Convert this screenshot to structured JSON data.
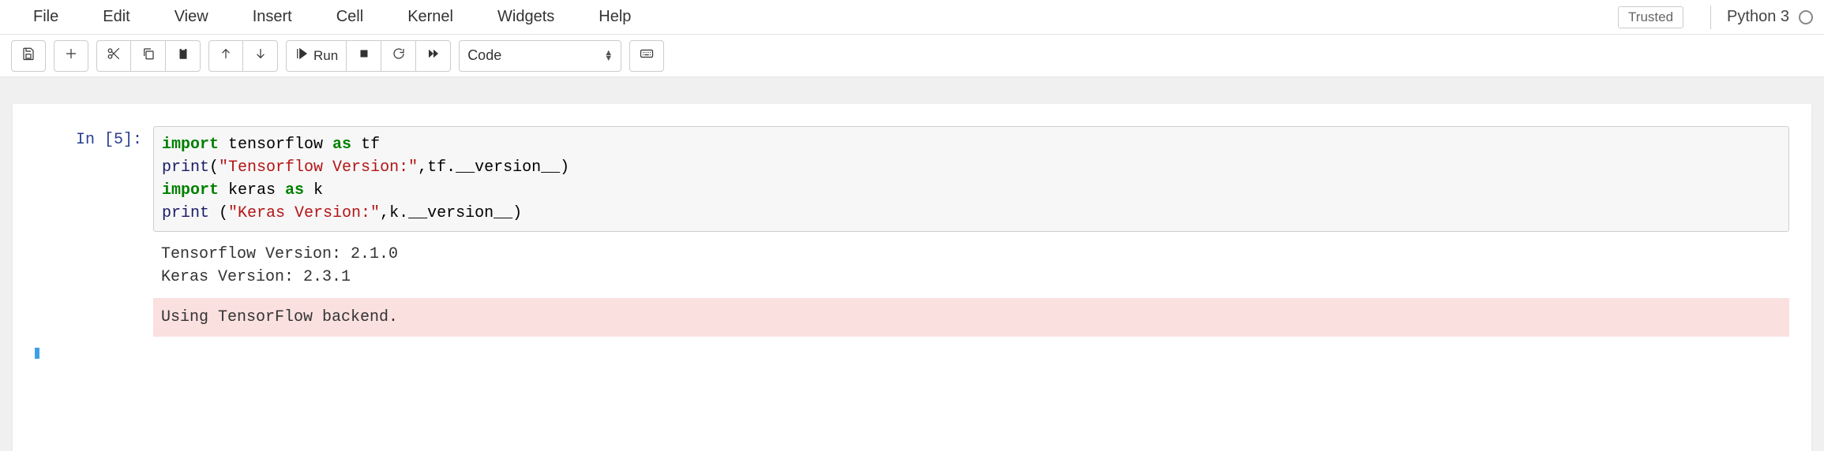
{
  "menubar": {
    "items": [
      "File",
      "Edit",
      "View",
      "Insert",
      "Cell",
      "Kernel",
      "Widgets",
      "Help"
    ],
    "trusted_label": "Trusted",
    "kernel_name": "Python 3"
  },
  "toolbar": {
    "save_title": "Save and Checkpoint",
    "insert_title": "Insert Cell Below",
    "cut_title": "Cut Cells",
    "copy_title": "Copy Cells",
    "paste_title": "Paste Cells Below",
    "up_title": "Move Cell Up",
    "down_title": "Move Cell Down",
    "run_label": "Run",
    "interrupt_title": "Interrupt Kernel",
    "restart_title": "Restart Kernel",
    "restart_run_title": "Restart and Run All",
    "cell_type_value": "Code",
    "cmd_palette_title": "Command Palette"
  },
  "cell": {
    "prompt": {
      "label": "In",
      "number": "5"
    },
    "code": {
      "line1": {
        "a": "import",
        "b": " tensorflow ",
        "c": "as",
        "d": " tf"
      },
      "line2": {
        "a": "print",
        "b": "(",
        "c": "\"Tensorflow Version:\"",
        "d": ",tf.__version__)"
      },
      "line3": {
        "a": "import",
        "b": " keras ",
        "c": "as",
        "d": " k"
      },
      "line4": {
        "a": "print",
        "b": " (",
        "c": "\"Keras Version:\"",
        "d": ",k.__version__)"
      }
    },
    "stdout": "Tensorflow Version: 2.1.0\nKeras Version: 2.3.1",
    "stderr": "Using TensorFlow backend."
  }
}
